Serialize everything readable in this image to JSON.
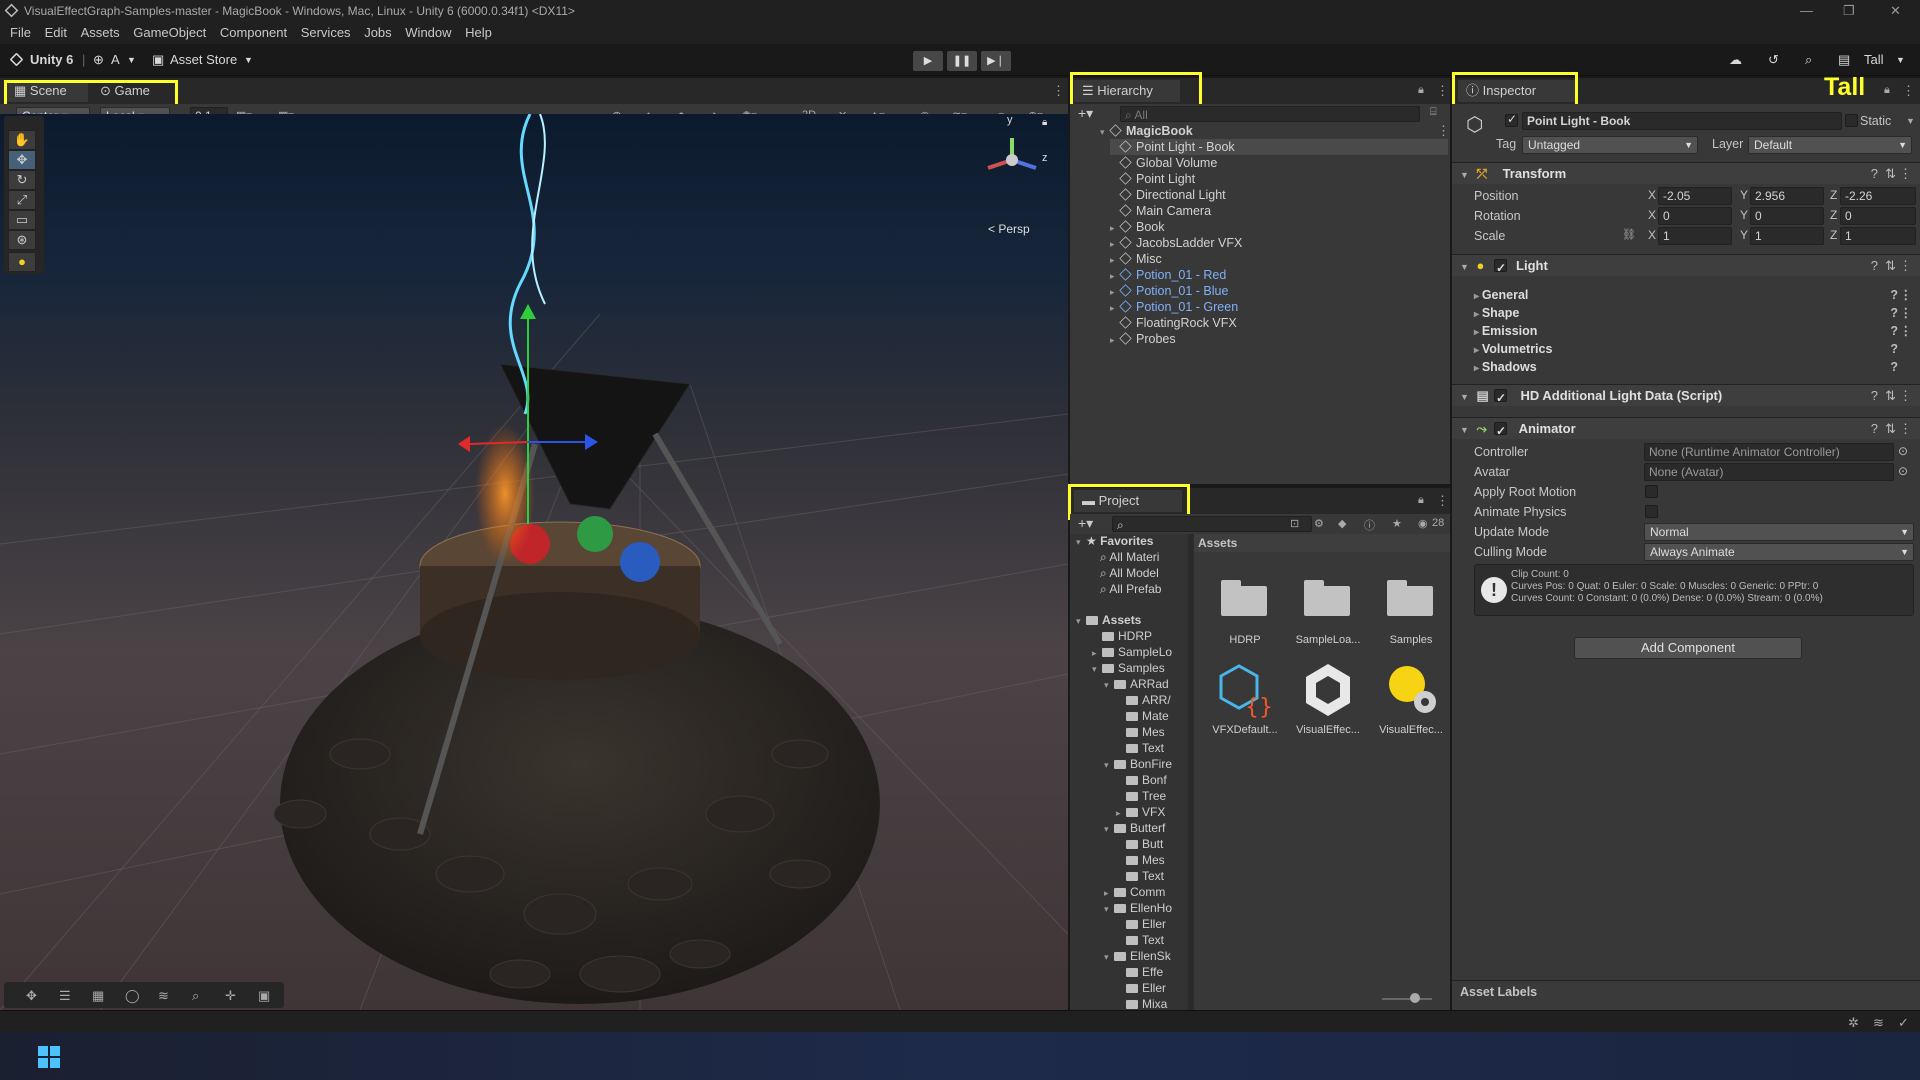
{
  "window": {
    "title": "VisualEffectGraph-Samples-master - MagicBook - Windows, Mac, Linux - Unity 6 (6000.0.34f1) <DX11>"
  },
  "menu": [
    "File",
    "Edit",
    "Assets",
    "GameObject",
    "Component",
    "Services",
    "Jobs",
    "Window",
    "Help"
  ],
  "toolbar": {
    "unity_label": "Unity 6",
    "account": "A",
    "asset_store": "Asset Store",
    "layout": "Tall"
  },
  "layout_label": "Tall",
  "scene_tabs": {
    "scene": "Scene",
    "game": "Game"
  },
  "scene_toolbar": {
    "pivot": "Center",
    "space": "Local",
    "snap": "0.1"
  },
  "scene_view": {
    "persp": "< Persp",
    "axis_y": "y",
    "axis_z": "z"
  },
  "hierarchy": {
    "tab": "Hierarchy",
    "search_placeholder": "All",
    "root": "MagicBook",
    "items": [
      {
        "label": "Point Light - Book",
        "selected": true,
        "arrow": false
      },
      {
        "label": "Global Volume",
        "arrow": false
      },
      {
        "label": "Point Light",
        "arrow": false
      },
      {
        "label": "Directional Light",
        "arrow": false
      },
      {
        "label": "Main Camera",
        "arrow": false
      },
      {
        "label": "Book",
        "arrow": true
      },
      {
        "label": "JacobsLadder VFX",
        "arrow": true
      },
      {
        "label": "Misc",
        "arrow": true
      },
      {
        "label": "Potion_01 - Red",
        "arrow": true,
        "prefab": true
      },
      {
        "label": "Potion_01 - Blue",
        "arrow": true,
        "prefab": true
      },
      {
        "label": "Potion_01 - Green",
        "arrow": true,
        "prefab": true
      },
      {
        "label": "FloatingRock VFX",
        "arrow": false
      },
      {
        "label": "Probes",
        "arrow": true
      }
    ]
  },
  "project": {
    "tab": "Project",
    "count": "28",
    "favorites": {
      "label": "Favorites",
      "items": [
        "All Materi",
        "All Model",
        "All Prefab"
      ]
    },
    "assets_root": "Assets",
    "tree": [
      {
        "label": "HDRP",
        "indent": 1,
        "arrow": ""
      },
      {
        "label": "SampleLo",
        "indent": 1,
        "arrow": "▸"
      },
      {
        "label": "Samples",
        "indent": 1,
        "arrow": "▾"
      },
      {
        "label": "ARRad",
        "indent": 2,
        "arrow": "▾"
      },
      {
        "label": "ARR/",
        "indent": 3,
        "arrow": ""
      },
      {
        "label": "Mate",
        "indent": 3,
        "arrow": ""
      },
      {
        "label": "Mes",
        "indent": 3,
        "arrow": ""
      },
      {
        "label": "Text",
        "indent": 3,
        "arrow": ""
      },
      {
        "label": "BonFire",
        "indent": 2,
        "arrow": "▾"
      },
      {
        "label": "Bonf",
        "indent": 3,
        "arrow": ""
      },
      {
        "label": "Tree",
        "indent": 3,
        "arrow": ""
      },
      {
        "label": "VFX",
        "indent": 3,
        "arrow": "▸"
      },
      {
        "label": "Butterf",
        "indent": 2,
        "arrow": "▾"
      },
      {
        "label": "Butt",
        "indent": 3,
        "arrow": ""
      },
      {
        "label": "Mes",
        "indent": 3,
        "arrow": ""
      },
      {
        "label": "Text",
        "indent": 3,
        "arrow": ""
      },
      {
        "label": "Comm",
        "indent": 2,
        "arrow": "▸"
      },
      {
        "label": "EllenHo",
        "indent": 2,
        "arrow": "▾"
      },
      {
        "label": "Eller",
        "indent": 3,
        "arrow": ""
      },
      {
        "label": "Text",
        "indent": 3,
        "arrow": ""
      },
      {
        "label": "EllenSk",
        "indent": 2,
        "arrow": "▾"
      },
      {
        "label": "Effe",
        "indent": 3,
        "arrow": ""
      },
      {
        "label": "Eller",
        "indent": 3,
        "arrow": ""
      },
      {
        "label": "Mixa",
        "indent": 3,
        "arrow": ""
      }
    ],
    "grid_header": "Assets",
    "grid": [
      {
        "label": "HDRP",
        "kind": "folder"
      },
      {
        "label": "SampleLoa...",
        "kind": "folder"
      },
      {
        "label": "Samples",
        "kind": "folder"
      },
      {
        "label": "VFXDefault...",
        "kind": "vfx"
      },
      {
        "label": "VisualEffec...",
        "kind": "unity"
      },
      {
        "label": "VisualEffec...",
        "kind": "settings"
      }
    ]
  },
  "inspector": {
    "tab": "Inspector",
    "object_name": "Point Light - Book",
    "static_label": "Static",
    "tag_label": "Tag",
    "tag_value": "Untagged",
    "layer_label": "Layer",
    "layer_value": "Default",
    "transform": {
      "title": "Transform",
      "position": {
        "label": "Position",
        "x": "-2.05",
        "y": "2.956",
        "z": "-2.26"
      },
      "rotation": {
        "label": "Rotation",
        "x": "0",
        "y": "0",
        "z": "0"
      },
      "scale": {
        "label": "Scale",
        "x": "1",
        "y": "1",
        "z": "1"
      }
    },
    "light": {
      "title": "Light",
      "sections": [
        "General",
        "Shape",
        "Emission",
        "Volumetrics",
        "Shadows"
      ]
    },
    "hd_light": {
      "title": "HD Additional Light Data (Script)"
    },
    "animator": {
      "title": "Animator",
      "controller_label": "Controller",
      "controller_value": "None (Runtime Animator Controller)",
      "avatar_label": "Avatar",
      "avatar_value": "None (Avatar)",
      "root_motion_label": "Apply Root Motion",
      "physics_label": "Animate Physics",
      "update_label": "Update Mode",
      "update_value": "Normal",
      "culling_label": "Culling Mode",
      "culling_value": "Always Animate",
      "info": [
        "Clip Count: 0",
        "Curves Pos: 0 Quat: 0 Euler: 0 Scale: 0 Muscles: 0 Generic: 0 PPtr: 0",
        "Curves Count: 0 Constant: 0 (0.0%) Dense: 0 (0.0%) Stream: 0 (0.0%)"
      ]
    },
    "add_component": "Add Component",
    "asset_labels": "Asset Labels"
  },
  "colors": {
    "highlight": "#ffff2a",
    "panel": "#383838",
    "prefab_blue": "#7fb1f5",
    "taskbar": "#1a2540"
  }
}
